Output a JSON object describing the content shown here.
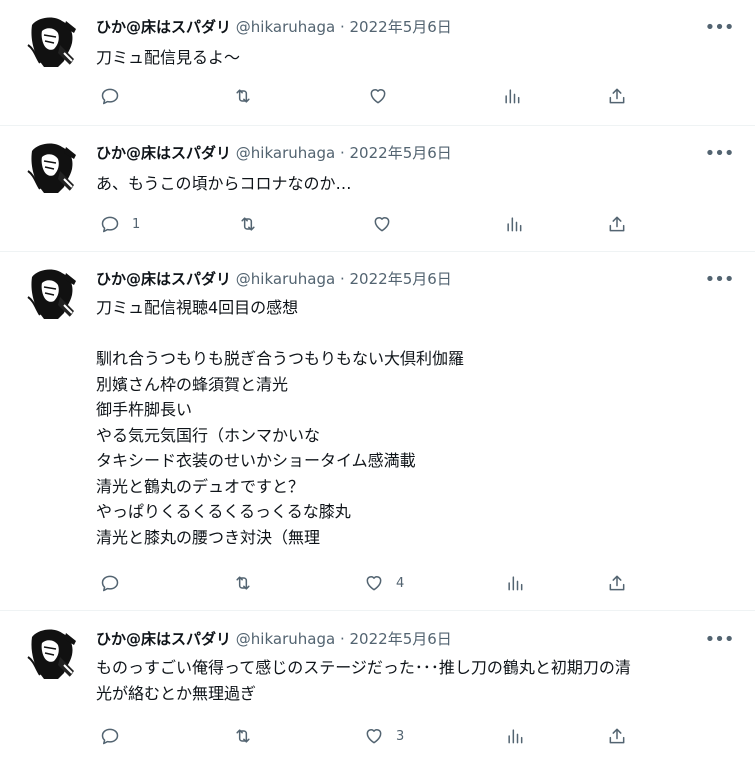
{
  "tweets": [
    {
      "name": "ひか@床はスパダリ",
      "handle": "@hikaruhaga",
      "dot": "·",
      "date": "2022年5月6日",
      "text": "刀ミュ配信見るよ〜",
      "reply_count": "",
      "like_count": ""
    },
    {
      "name": "ひか@床はスパダリ",
      "handle": "@hikaruhaga",
      "dot": "·",
      "date": "2022年5月6日",
      "text": "あ、もうこの頃からコロナなのか…",
      "reply_count": "1",
      "like_count": ""
    },
    {
      "name": "ひか@床はスパダリ",
      "handle": "@hikaruhaga",
      "dot": "·",
      "date": "2022年5月6日",
      "text": "刀ミュ配信視聴4回目の感想\n\n馴れ合うつもりも脱ぎ合うつもりもない大倶利伽羅\n別嬪さん枠の蜂須賀と清光\n御手杵脚長い\nやる気元気国行（ホンマかいな\nタキシード衣装のせいかショータイム感満載\n清光と鶴丸のデュオですと？\nやっぱりくるくるくるっくるな膝丸\n清光と膝丸の腰つき対決（無理",
      "reply_count": "",
      "like_count": "4"
    },
    {
      "name": "ひか@床はスパダリ",
      "handle": "@hikaruhaga",
      "dot": "·",
      "date": "2022年5月6日",
      "text": "ものっすごい俺得って感じのステージだった･･･推し刀の鶴丸と初期刀の清\n光が絡むとか無理過ぎ",
      "reply_count": "",
      "like_count": "3"
    }
  ],
  "more_glyph": "•••",
  "icons": {
    "avatar": "avatar-image",
    "reply": "reply-icon",
    "retweet": "retweet-icon",
    "like": "heart-icon",
    "views": "views-chart-icon",
    "share": "share-icon",
    "more": "more-icon"
  },
  "colors": {
    "text": "#0f1419",
    "secondary": "#536471",
    "separator": "#eff3f4",
    "background": "#ffffff"
  }
}
